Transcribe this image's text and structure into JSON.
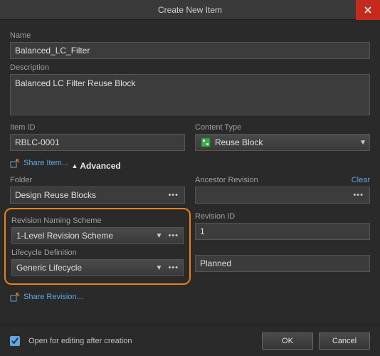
{
  "window": {
    "title": "Create New Item"
  },
  "name": {
    "label": "Name",
    "value": "Balanced_LC_Filter"
  },
  "description": {
    "label": "Description",
    "value": "Balanced LC Filter Reuse Block"
  },
  "item_id": {
    "label": "Item ID",
    "value": "RBLC-0001"
  },
  "content_type": {
    "label": "Content Type",
    "value": "Reuse Block"
  },
  "share_item": {
    "label": "Share Item..."
  },
  "advanced": {
    "label": "Advanced"
  },
  "folder": {
    "label": "Folder",
    "value": "Design Reuse Blocks"
  },
  "ancestor": {
    "label": "Ancestor Revision",
    "clear": "Clear",
    "value": ""
  },
  "rev_scheme": {
    "label": "Revision Naming Scheme",
    "value": "1-Level Revision Scheme"
  },
  "rev_id": {
    "label": "Revision ID",
    "value": "1"
  },
  "lifecycle": {
    "label": "Lifecycle Definition",
    "value": "Generic Lifecycle"
  },
  "lifecycle_state": {
    "value": "Planned"
  },
  "share_rev": {
    "label": "Share Revision..."
  },
  "footer": {
    "open_after": "Open for editing after creation",
    "ok": "OK",
    "cancel": "Cancel"
  }
}
